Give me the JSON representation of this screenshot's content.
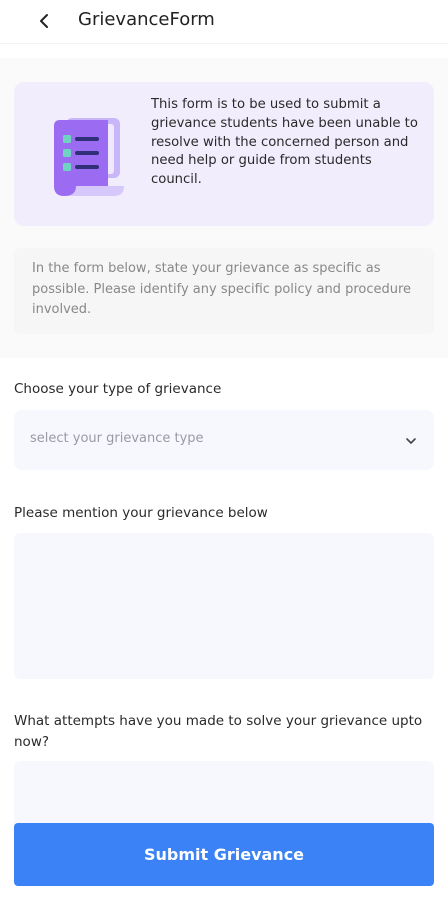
{
  "header": {
    "title": "GrievanceForm",
    "back_icon": "back-arrow-icon"
  },
  "info_card": {
    "text": "This form is to be used to submit a grievance students have been unable to resolve with the concerned person and need help or guide from students council.",
    "illustration_icon": "document-checklist-icon",
    "accent_colors": [
      "#9b6bf2",
      "#c9b6f8",
      "#6fd3c2",
      "#2f2f7a"
    ]
  },
  "note": {
    "text": "In the form below, state your grievance as specific as possible. Please identify any specific policy and procedure involved."
  },
  "grievance_type": {
    "label": "Choose your type of grievance",
    "placeholder": "select your grievance type",
    "icon": "chevron-down-icon"
  },
  "grievance_details": {
    "label": "Please mention your grievance below",
    "value": ""
  },
  "attempts": {
    "label": "What attempts have you made to solve your grievance upto now?",
    "value": ""
  },
  "submit": {
    "label": "Submit Grievance",
    "color": "#3b82f6"
  }
}
